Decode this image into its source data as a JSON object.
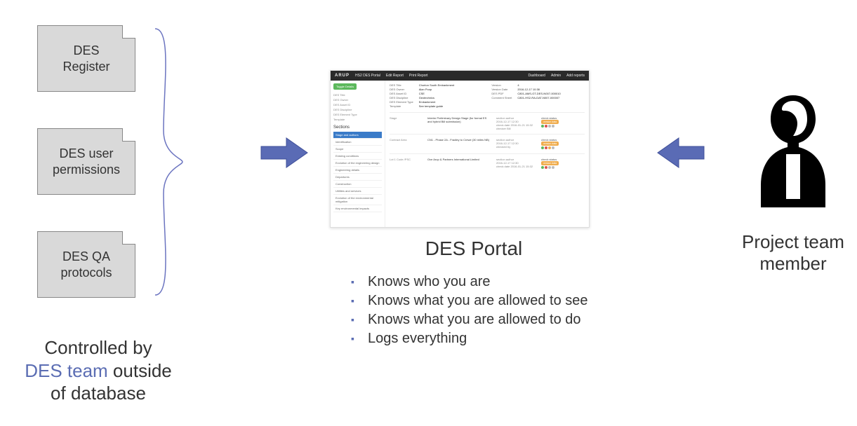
{
  "left_boxes": {
    "register": "DES\nRegister",
    "permissions": "DES user\npermissions",
    "qa": "DES QA\nprotocols"
  },
  "left_caption": {
    "line1": "Controlled by",
    "accent": "DES team",
    "line2_rest": " outside",
    "line3": "of database"
  },
  "portal_title": "DES Portal",
  "bullets": [
    "Knows who you are",
    "Knows what you are allowed to see",
    "Knows what you are allowed to do",
    "Logs everything"
  ],
  "person_label": "Project team\nmember",
  "screenshot": {
    "brand": "ARUP",
    "app": "HS2 DES Portal",
    "nav": {
      "edit": "Edit Report",
      "print": "Print Report",
      "dashboard": "Dashboard",
      "admin": "Admin",
      "add": "Add reports"
    },
    "toggle": "Toggle Details",
    "left_fields": {
      "title_lab": "DES Title",
      "title_val": "Chorton South Embankment",
      "owner_lab": "DES Owner",
      "owner_val": "Alan Poop",
      "asset_lab": "DES Asset ID",
      "asset_val": "CSE",
      "disc_lab": "DES Discipline",
      "disc_val": "Geotechnics",
      "elem_lab": "DES Element Type",
      "elem_val": "Embankment",
      "tmpl_lab": "Template",
      "tmpl_val": "See template guide"
    },
    "right_fields": {
      "version_lab": "Version",
      "version_val": "4",
      "vdate_lab": "Version Date",
      "vdate_val": "2016-12-17 10:38",
      "pdf_lab": "DES PDF",
      "pdf_val": "C801-AMS-GT-DES-N007-000010",
      "cs_lab": "Comment Sheet",
      "cs_val": "C801-HS2-RA-DAT-N007-000007"
    },
    "sections_title": "Sections",
    "sections": [
      "Stage and authors",
      "Identification",
      "Scope",
      "Existing conditions",
      "Evolution of the engineering design",
      "Engineering details",
      "Departures",
      "Construction",
      "Utilities and services",
      "Evolution of the environmental mitigation",
      "Key environmental impacts"
    ],
    "rows": [
      {
        "lab": "Stage",
        "desc": "Interim Preliminary Design Stage (for formal ES and hybrid Bill submission)",
        "author": "section author",
        "date": "2016-12-17 12:30",
        "status": "check status",
        "badge": "version data",
        "extra": "check date 2016-01-21 15:32  checker Bill"
      },
      {
        "lab": "Contract Area",
        "desc": "CN1 - Phase 2A - Fradley to Crewe (30 miles NB)",
        "author": "section author",
        "date": "2016-12-17 12:30",
        "status": "check status",
        "badge": "version data",
        "extra": "checked by"
      },
      {
        "lab": "Lot 1 Code /PSC",
        "desc": "Ove Arup & Partners International Limited",
        "author": "section author",
        "date": "2016-12-17 12:30",
        "status": "check status",
        "badge": "version data",
        "extra": "check date 2016-01-21 15:32"
      }
    ]
  }
}
